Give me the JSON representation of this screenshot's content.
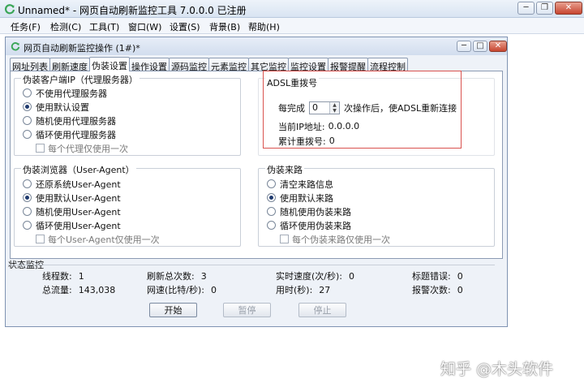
{
  "app": {
    "title": "Unnamed* - 网页自动刷新监控工具 7.0.0.0  已注册",
    "menu": [
      "任务(F)",
      "检测(C)",
      "工具(T)",
      "窗口(W)",
      "设置(S)",
      "背景(B)",
      "帮助(H)"
    ]
  },
  "inner_window": {
    "title": "网页自动刷新监控操作  (1#)*",
    "tabs": [
      "网址列表",
      "刷新速度",
      "伪装设置",
      "操作设置",
      "源码监控",
      "元素监控",
      "其它监控",
      "监控设置",
      "报警提醒",
      "流程控制"
    ],
    "active_tab": "伪装设置"
  },
  "proxy_group": {
    "title": "伪装客户端IP（代理服务器）",
    "options": [
      "不使用代理服务器",
      "使用默认设置",
      "随机使用代理服务器",
      "循环使用代理服务器"
    ],
    "selected": 1,
    "checkbox": "每个代理仅使用一次"
  },
  "adsl_group": {
    "title": "ADSL重拨号",
    "every_label": "每完成",
    "every_value": "0",
    "after_label": "次操作后，使ADSL重新连接",
    "ip_label": "当前IP地址:",
    "ip_value": "0.0.0.0",
    "count_label": "累计重拨号:",
    "count_value": "0"
  },
  "browser_group": {
    "title": "伪装浏览器（User-Agent）",
    "options": [
      "还原系统User-Agent",
      "使用默认User-Agent",
      "随机使用User-Agent",
      "循环使用User-Agent"
    ],
    "selected": 1,
    "checkbox": "每个User-Agent仅使用一次"
  },
  "referer_group": {
    "title": "伪装来路",
    "options": [
      "清空来路信息",
      "使用默认来路",
      "随机使用伪装来路",
      "循环使用伪装来路"
    ],
    "selected": 1,
    "checkbox": "每个伪装来路仅使用一次"
  },
  "status": {
    "title": "状态监控",
    "threads_label": "线程数:",
    "threads_value": "1",
    "refresh_label": "刷新总次数:",
    "refresh_value": "3",
    "speed_label": "实时速度(次/秒):",
    "speed_value": "0",
    "title_err_label": "标题错误:",
    "title_err_value": "0",
    "traffic_label": "总流量:",
    "traffic_value": "143,038",
    "rate_label": "网速(比特/秒):",
    "rate_value": "0",
    "time_label": "用时(秒):",
    "time_value": "27",
    "alarm_label": "报警次数:",
    "alarm_value": "0"
  },
  "buttons": {
    "start": "开始",
    "pause": "暂停",
    "stop": "停止"
  },
  "watermark": "知乎 @木头软件",
  "colors": {
    "highlight": "#d9534f",
    "title_bar": "#d9e4f2",
    "app_icon": "#3aa657"
  }
}
